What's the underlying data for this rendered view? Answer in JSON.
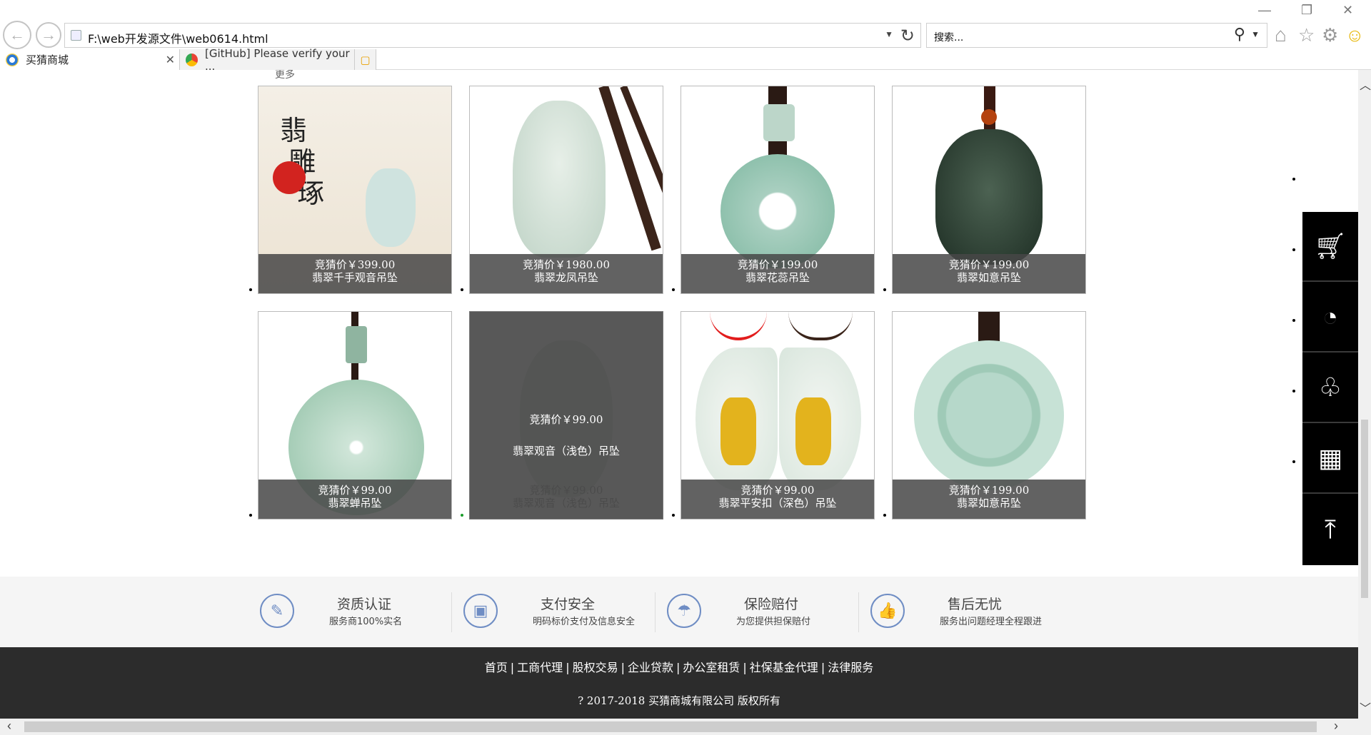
{
  "browser": {
    "url": "F:\\web开发源文件\\web0614.html",
    "search_placeholder": "搜索...",
    "tabs": [
      {
        "label": "买猜商城"
      },
      {
        "label": "[GitHub] Please verify your ..."
      }
    ]
  },
  "page": {
    "partial_heading": "更多",
    "products": [
      {
        "price": "竞猜价￥399.00",
        "name": "翡翠千手观音吊坠"
      },
      {
        "price": "竞猜价￥1980.00",
        "name": "翡翠龙凤吊坠"
      },
      {
        "price": "竞猜价￥199.00",
        "name": "翡翠花蕊吊坠"
      },
      {
        "price": "竞猜价￥199.00",
        "name": "翡翠如意吊坠"
      },
      {
        "price": "竞猜价￥99.00",
        "name": "翡翠蝉吊坠"
      },
      {
        "price": "竞猜价￥99.00",
        "name": "翡翠观音（浅色）吊坠"
      },
      {
        "price": "竞猜价￥99.00",
        "name": "翡翠平安扣（深色）吊坠"
      },
      {
        "price": "竞猜价￥199.00",
        "name": "翡翠如意吊坠"
      }
    ],
    "badges": [
      {
        "title": "资质认证",
        "sub": "服务商100%实名"
      },
      {
        "title": "支付安全",
        "sub": "明码标价支付及信息安全"
      },
      {
        "title": "保险赔付",
        "sub": "为您提供担保赔付"
      },
      {
        "title": "售后无忧",
        "sub": "服务出问题经理全程跟进"
      }
    ],
    "footer_links": [
      "首页",
      "工商代理",
      "股权交易",
      "企业贷款",
      "办公室租赁",
      "社保基金代理",
      "法律服务"
    ],
    "copyright": "? 2017-2018 买猜商城有限公司 版权所有",
    "sidebar_icons": [
      "cart-icon",
      "qq-penguin-icon",
      "footprint-icon",
      "qrcode-icon",
      "back-to-top-icon"
    ]
  }
}
